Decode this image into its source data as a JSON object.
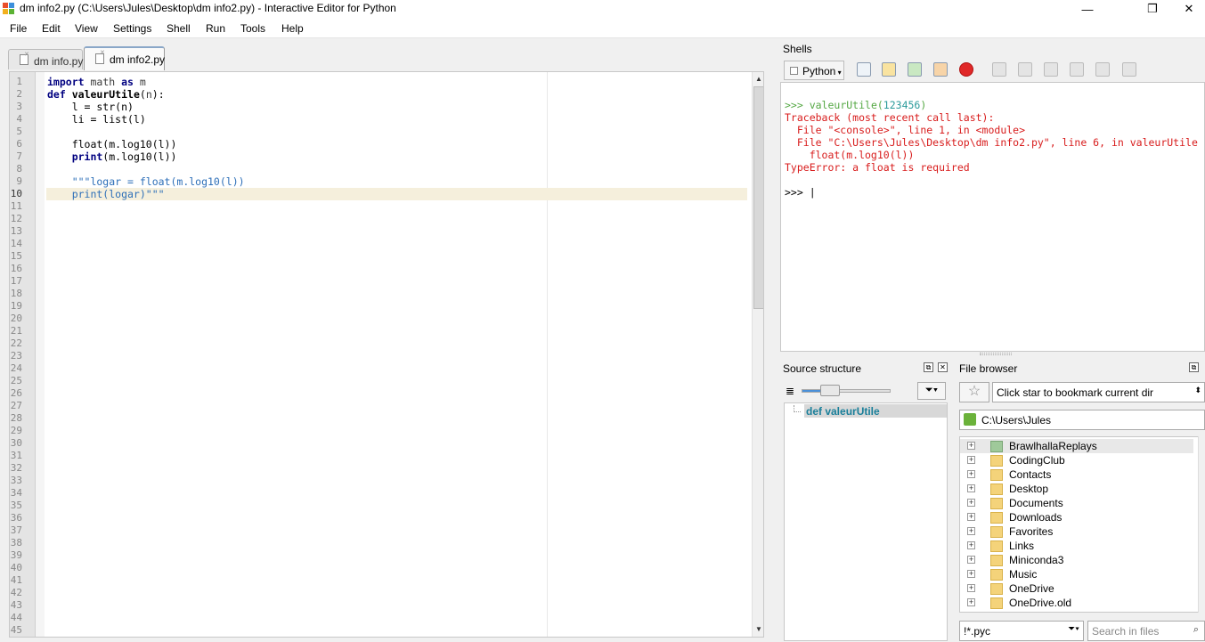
{
  "window": {
    "title": "dm info2.py (C:\\Users\\Jules\\Desktop\\dm info2.py) - Interactive Editor for Python",
    "minimize": "—",
    "maximize": "❐",
    "close": "✕"
  },
  "menu": [
    "File",
    "Edit",
    "View",
    "Settings",
    "Shell",
    "Run",
    "Tools",
    "Help"
  ],
  "editor": {
    "tabs": [
      {
        "label": "dm info.py",
        "active": false
      },
      {
        "label": "dm info2.py",
        "active": true
      }
    ],
    "current_line": 10,
    "line_count": 45
  },
  "shells": {
    "label": "Shells",
    "python_button": "Python",
    "toolbar_icons": [
      "new-file-icon",
      "open-file-icon",
      "reload-icon",
      "run-icon",
      "stop-icon",
      "debug-icon",
      "step-icon",
      "step-in-icon",
      "step-over-icon",
      "clear-icon",
      "list-icon"
    ],
    "output": [
      {
        "kind": "prompt",
        "prompt": ">>> ",
        "call": "valeurUtile(",
        "arg": "123456",
        "end": ")"
      },
      {
        "kind": "error",
        "text": "Traceback (most recent call last):"
      },
      {
        "kind": "error",
        "text": "  File \"<console>\", line 1, in <module>"
      },
      {
        "kind": "error",
        "text": "  File \"C:\\Users\\Jules\\Desktop\\dm info2.py\", line 6, in valeurUtile"
      },
      {
        "kind": "error",
        "text": "    float(m.log10(l))"
      },
      {
        "kind": "error",
        "text": "TypeError: a float is required"
      },
      {
        "kind": "blank",
        "text": ""
      },
      {
        "kind": "prompt_empty",
        "prompt": ">>> |"
      }
    ]
  },
  "source_structure": {
    "label": "Source structure",
    "item": "def valeurUtile",
    "filter_icon": "filter-icon"
  },
  "file_browser": {
    "label": "File browser",
    "bookmark_text": "Click star to bookmark current dir",
    "path": "C:\\Users\\Jules",
    "folders": [
      "BrawlhallaReplays",
      "CodingClub",
      "Contacts",
      "Desktop",
      "Documents",
      "Downloads",
      "Favorites",
      "Links",
      "Miniconda3",
      "Music",
      "OneDrive",
      "OneDrive.old"
    ],
    "filter_value": "!*.pyc",
    "search_placeholder": "Search in files"
  }
}
